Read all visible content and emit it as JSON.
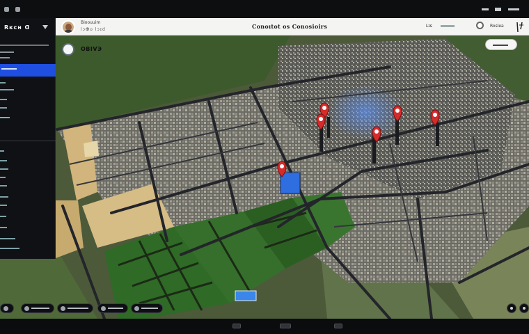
{
  "app": {
    "brand": "Rᴋcʜ  ᗡ",
    "header_title": "Conoıtot os Conosioirs",
    "user_name": "Bioouuim",
    "user_sub": "lɔⴲʋ lɔɪⅾ",
    "header_link": "Lɪs",
    "header_btn": "Rosleǝ",
    "zoom_label": "OBIVЭ"
  },
  "map": {
    "pins": [
      {
        "label": "pin-1",
        "color": "#d62b2b"
      },
      {
        "label": "pin-2",
        "color": "#d62b2b"
      },
      {
        "label": "pin-3",
        "color": "#d62b2b"
      },
      {
        "label": "pin-4",
        "color": "#d62b2b"
      },
      {
        "label": "pin-5",
        "color": "#d62b2b"
      },
      {
        "label": "pin-6",
        "color": "#d62b2b"
      }
    ],
    "colors": {
      "farmland": "#2f6a26",
      "urban": "#7a7a72",
      "sand": "#d2b77e",
      "water": "#3d7ae0"
    }
  },
  "sidebar": {
    "active_color": "#1f4fe0"
  }
}
